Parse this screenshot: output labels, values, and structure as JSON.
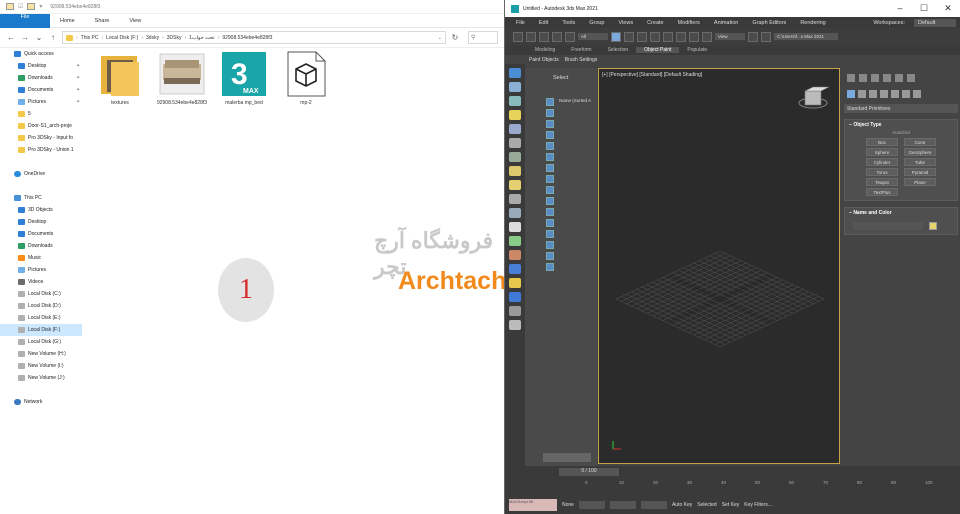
{
  "explorer": {
    "title": "92908.534ebe4e828f3",
    "ribbon_tabs": [
      "File",
      "Home",
      "Share",
      "View"
    ],
    "address": [
      "This PC",
      "Local Disk (F:)",
      "3dsky",
      "3DSky",
      "تخت خواب1",
      "92908.534ebe4e828f3"
    ],
    "nav": [
      {
        "label": "Quick access",
        "icon": "star-icon",
        "kind": "blue",
        "indent": 14
      },
      {
        "label": "Desktop",
        "icon": "desktop-icon",
        "kind": "blue",
        "indent": 18,
        "pin": true
      },
      {
        "label": "Downloads",
        "icon": "download-icon",
        "kind": "down",
        "indent": 18,
        "pin": true
      },
      {
        "label": "Documents",
        "icon": "documents-icon",
        "kind": "blue",
        "indent": 18,
        "pin": true
      },
      {
        "label": "Pictures",
        "icon": "pictures-icon",
        "kind": "pic",
        "indent": 18,
        "pin": true
      },
      {
        "label": "5",
        "icon": "folder-icon",
        "kind": "folder",
        "indent": 18
      },
      {
        "label": "Door-S1_arch-proje",
        "icon": "folder-icon",
        "kind": "folder",
        "indent": 18
      },
      {
        "label": "Pro 3DSky - Input fo",
        "icon": "folder-icon",
        "kind": "folder",
        "indent": 18
      },
      {
        "label": "Pro 3DSky - Union 1",
        "icon": "folder-icon",
        "kind": "folder",
        "indent": 18
      },
      {
        "label": "",
        "icon": "",
        "kind": "",
        "indent": 18
      },
      {
        "label": "OneDrive",
        "icon": "onedrive-icon",
        "kind": "cloud",
        "indent": 14
      },
      {
        "label": "",
        "icon": "",
        "kind": "",
        "indent": 18
      },
      {
        "label": "This PC",
        "icon": "pc-icon",
        "kind": "pc",
        "indent": 14
      },
      {
        "label": "3D Objects",
        "icon": "3d-objects-icon",
        "kind": "blue",
        "indent": 18
      },
      {
        "label": "Desktop",
        "icon": "desktop-icon",
        "kind": "blue",
        "indent": 18
      },
      {
        "label": "Documents",
        "icon": "documents-icon",
        "kind": "blue",
        "indent": 18
      },
      {
        "label": "Downloads",
        "icon": "download-icon",
        "kind": "down",
        "indent": 18
      },
      {
        "label": "Music",
        "icon": "music-icon",
        "kind": "music",
        "indent": 18
      },
      {
        "label": "Pictures",
        "icon": "pictures-icon",
        "kind": "pic",
        "indent": 18
      },
      {
        "label": "Videos",
        "icon": "videos-icon",
        "kind": "video",
        "indent": 18
      },
      {
        "label": "Local Disk (C:)",
        "icon": "disk-icon",
        "kind": "disk",
        "indent": 18
      },
      {
        "label": "Local Disk (D:)",
        "icon": "disk-icon",
        "kind": "disk",
        "indent": 18
      },
      {
        "label": "Local Disk (E:)",
        "icon": "disk-icon",
        "kind": "disk",
        "indent": 18
      },
      {
        "label": "Local Disk (F:)",
        "icon": "disk-icon",
        "kind": "disk",
        "indent": 18,
        "selected": true
      },
      {
        "label": "Local Disk (G:)",
        "icon": "disk-icon",
        "kind": "disk",
        "indent": 18
      },
      {
        "label": "New Volume (H:)",
        "icon": "disk-icon",
        "kind": "disk",
        "indent": 18
      },
      {
        "label": "New Volume (I:)",
        "icon": "disk-icon",
        "kind": "disk",
        "indent": 18
      },
      {
        "label": "New Volume (J:)",
        "icon": "disk-icon",
        "kind": "disk",
        "indent": 18
      },
      {
        "label": "",
        "icon": "",
        "kind": "",
        "indent": 18
      },
      {
        "label": "Network",
        "icon": "network-icon",
        "kind": "net",
        "indent": 14
      }
    ],
    "files": [
      {
        "name": "textures",
        "kind": "folder"
      },
      {
        "name": "92908.534ebe4e828f3",
        "kind": "image"
      },
      {
        "name": "malerba mp_bed",
        "kind": "max"
      },
      {
        "name": "mp-2",
        "kind": "obj"
      }
    ],
    "status_line": "4 items"
  },
  "overlay": {
    "number": "1",
    "watermark_fa": "فروشگاه آرچ تچر",
    "watermark_en": "Archtachr.ir"
  },
  "max": {
    "title": "Untitled - Autodesk 3ds Max 2021",
    "menu": [
      "File",
      "Edit",
      "Tools",
      "Group",
      "Views",
      "Create",
      "Modifiers",
      "Animation",
      "Graph Editors",
      "Rendering"
    ],
    "workspace_label": "Workspaces:",
    "workspace_value": "Default",
    "filter_value": "All",
    "view_value": "View",
    "project_path": "C:\\Users\\f...s Max 2021",
    "ribbon_tabs": [
      "Modeling",
      "Freeform",
      "Selection",
      "Object Paint",
      "Populate"
    ],
    "active_ribbon_tab": "Object Paint",
    "subtabs": [
      "Paint Objects",
      "Brush Settings"
    ],
    "scene_select": "Select",
    "scene_header": "Name (Sorted A",
    "viewport_label": "[+] [Perspective] [Standard] [Default Shading]",
    "cmd_dropdown": "Standard Primitives",
    "object_type_header": "Object Type",
    "autogrid": "AutoGrid",
    "primitives": [
      "Box",
      "Cone",
      "Sphere",
      "GeoSphere",
      "Cylinder",
      "Tube",
      "Torus",
      "Pyramid",
      "Teapot",
      "Plane",
      "TextPlus"
    ],
    "name_color_header": "Name and Color",
    "frame_counter": "0 / 100",
    "tick_labels": [
      "0",
      "10",
      "20",
      "30",
      "40",
      "50",
      "60",
      "70",
      "80",
      "90",
      "100"
    ],
    "maxscript": "MAXScript Mi",
    "status_labels": [
      "None",
      "Auto Key",
      "Selected",
      "Set Key",
      "Key Filters..."
    ]
  }
}
